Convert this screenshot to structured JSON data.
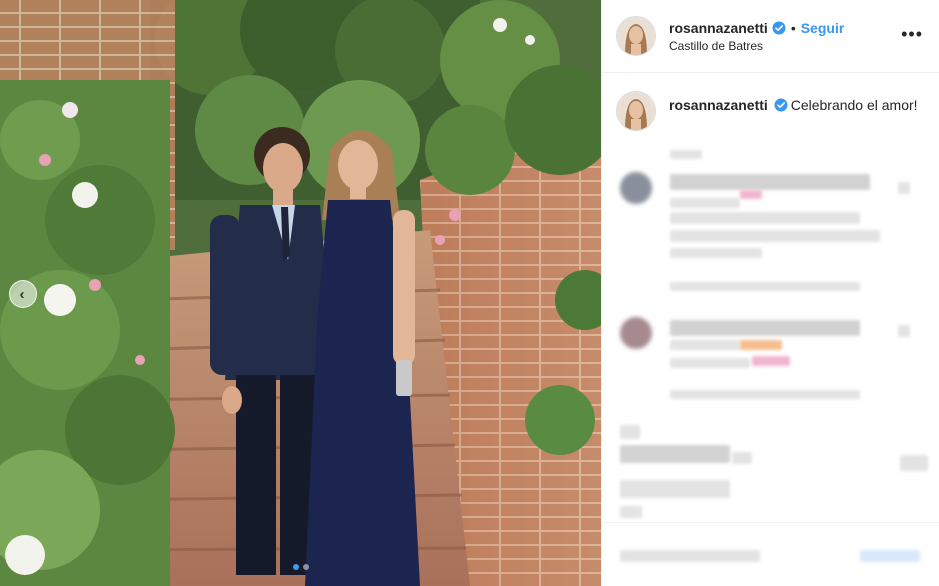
{
  "post": {
    "username": "rosannazanetti",
    "verified": true,
    "follow_label": "Seguir",
    "separator": "•",
    "location": "Castillo de Batres",
    "more_label": "•••",
    "caption_text": "Celebrando el amor!"
  },
  "carousel": {
    "prev_label": "‹",
    "slide_count": 2,
    "active_slide": 1
  },
  "colors": {
    "accent": "#3897f0",
    "verified": "#3897f0",
    "text": "#262626",
    "border": "#efefef"
  },
  "icons": [
    "verified-badge-icon",
    "more-options-icon",
    "carousel-prev-icon"
  ]
}
